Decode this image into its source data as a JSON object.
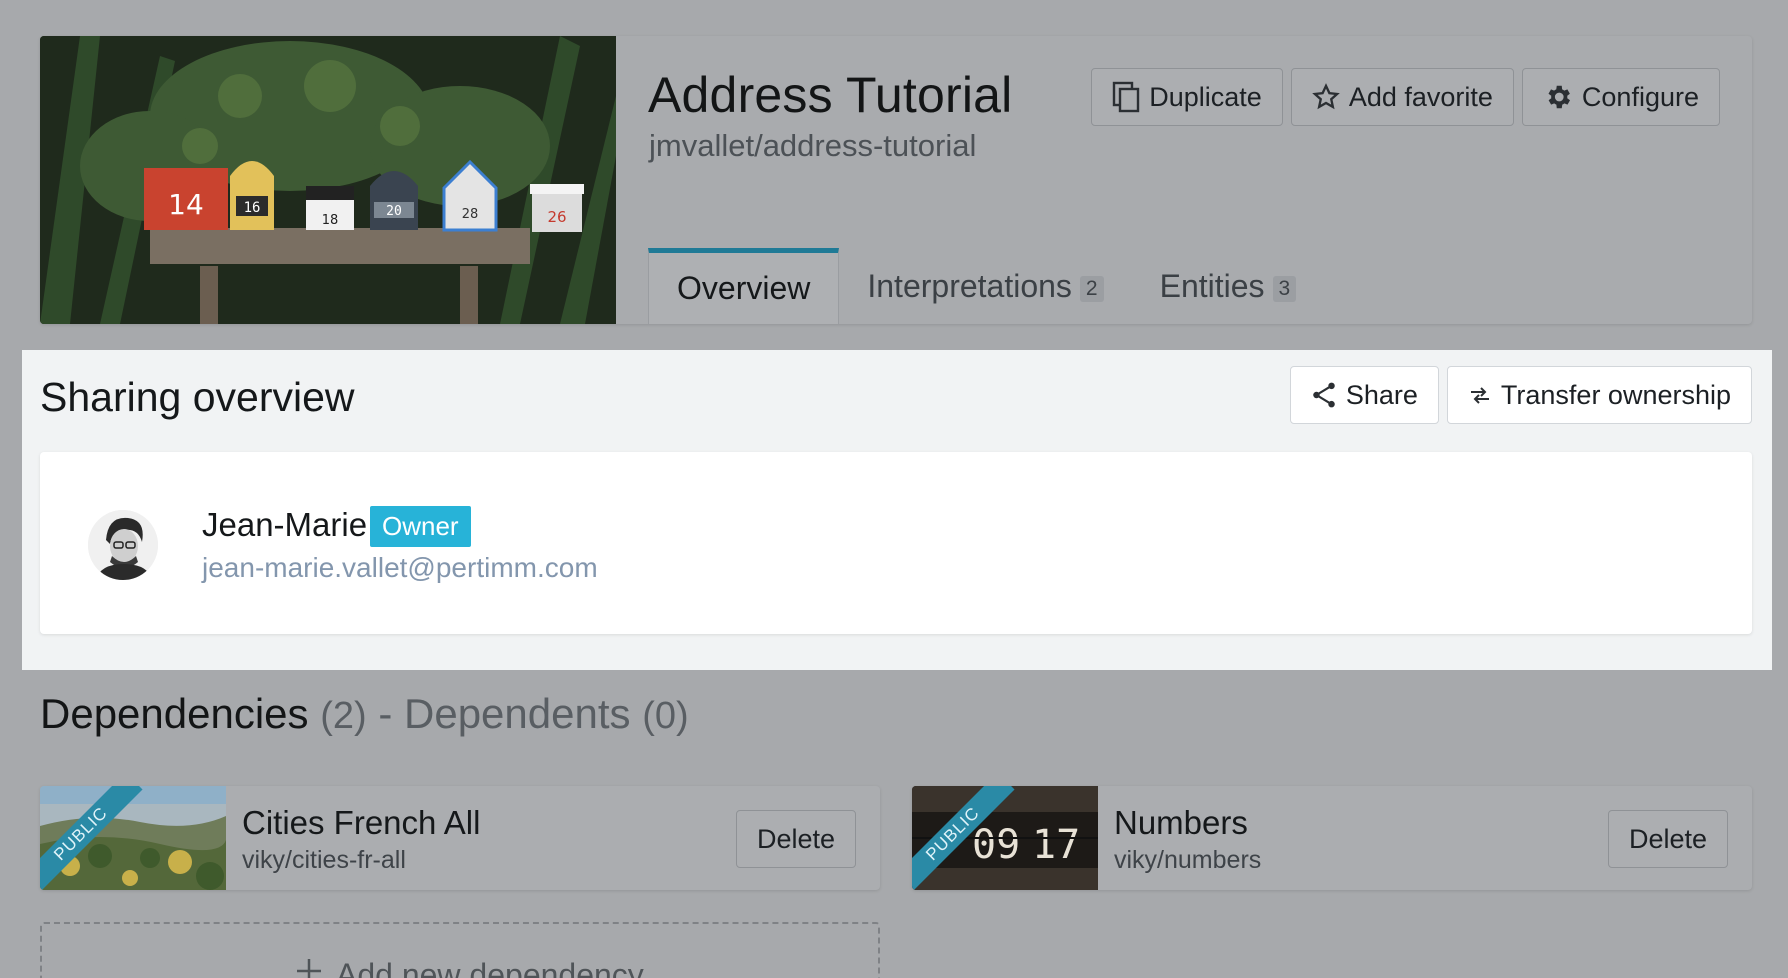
{
  "header": {
    "title": "Address Tutorial",
    "slug": "jmvallet/address-tutorial",
    "actions": {
      "duplicate": "Duplicate",
      "add_favorite": "Add favorite",
      "configure": "Configure"
    },
    "tabs": [
      {
        "label": "Overview",
        "count": null,
        "active": true
      },
      {
        "label": "Interpretations",
        "count": "2",
        "active": false
      },
      {
        "label": "Entities",
        "count": "3",
        "active": false
      }
    ],
    "cover_mailbox_numbers": [
      "14",
      "16",
      "18",
      "20",
      "28",
      "26"
    ]
  },
  "sharing": {
    "title": "Sharing overview",
    "share_label": "Share",
    "transfer_label": "Transfer ownership",
    "member": {
      "name": "Jean-Marie",
      "role": "Owner",
      "email": "jean-marie.vallet@pertimm.com"
    }
  },
  "dependencies": {
    "title": "Dependencies",
    "count": "(2)",
    "separator": "-",
    "dependents_title": "Dependents",
    "dependents_count": "(0)",
    "items": [
      {
        "name": "Cities French All",
        "slug": "viky/cities-fr-all",
        "badge": "PUBLIC",
        "delete_label": "Delete"
      },
      {
        "name": "Numbers",
        "slug": "viky/numbers",
        "badge": "PUBLIC",
        "delete_label": "Delete"
      }
    ],
    "add_label": "Add new dependency"
  },
  "colors": {
    "accent": "#1f7a96",
    "owner_badge": "#27b3d8",
    "email": "#8396ad",
    "overlay": "#a7a9ac"
  }
}
